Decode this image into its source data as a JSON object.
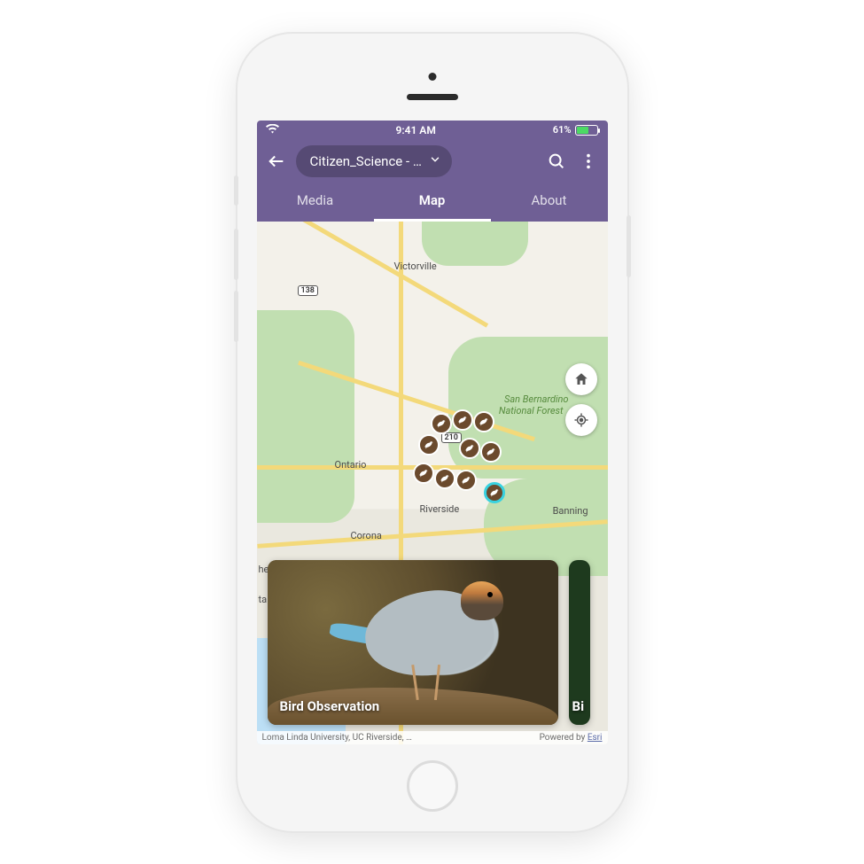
{
  "status": {
    "time": "9:41 AM",
    "battery_pct": "61%",
    "battery_color": "#4cd964",
    "battery_fill_pct": 61
  },
  "toolbar": {
    "layer_label": "Citizen_Science - …"
  },
  "tabs": [
    {
      "label": "Media",
      "active": false
    },
    {
      "label": "Map",
      "active": true
    },
    {
      "label": "About",
      "active": false
    }
  ],
  "map": {
    "places": {
      "victorville": "Victorville",
      "ontario": "Ontario",
      "riverside": "Riverside",
      "corona": "Corona",
      "banning": "Banning",
      "anaheim_partial": "heim",
      "santa_ana_partial": "ta Ana",
      "sb_forest_l1": "San Bernardino",
      "sb_forest_l2": "National Forest"
    },
    "shields": {
      "r138": "138",
      "r210": "210"
    },
    "markers_count": 10
  },
  "cards": [
    {
      "title": "Bird Observation"
    },
    {
      "title_partial": "Bi"
    }
  ],
  "attribution": {
    "sources": "Loma Linda University, UC Riverside, …",
    "powered_prefix": "Powered by ",
    "powered_link": "Esri"
  },
  "colors": {
    "header": "#6f5f95"
  }
}
